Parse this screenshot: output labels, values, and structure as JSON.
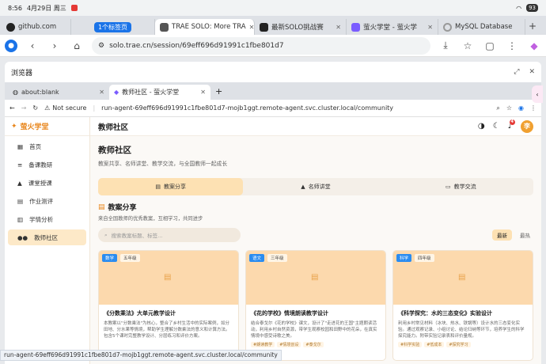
{
  "status": {
    "time": "8:56",
    "date": "4月29日 周三",
    "battery": "93"
  },
  "outer_tabs": [
    {
      "label": "github.com",
      "color": "#222"
    },
    {
      "label": "1个标签页",
      "chip": true
    },
    {
      "label": "TRAE SOLO: More TRA",
      "color": "#555",
      "active": true
    },
    {
      "label": "最新SOLO挑战赛",
      "color": "#222"
    },
    {
      "label": "萤火学堂 - 萤火学",
      "color": "#7a5cff"
    },
    {
      "label": "MySQL Database",
      "color": "#999"
    }
  ],
  "outer_url": "solo.trae.cn/session/69eff696d91991c1fbe801d7",
  "inner": {
    "title": "浏览器",
    "tabs": [
      {
        "label": "about:blank"
      },
      {
        "label": "教师社区 - 萤火学堂",
        "active": true
      }
    ],
    "not_secure": "Not secure",
    "url": "run-agent-69eff696d91991c1fbe801d7-mojb1ggt.remote-agent.svc.cluster.local/community"
  },
  "app": {
    "brand": "萤火学堂",
    "nav": [
      {
        "label": "首页",
        "icon": "home-icon"
      },
      {
        "label": "备课教研",
        "icon": "edit-icon"
      },
      {
        "label": "课堂授课",
        "icon": "graduation-icon"
      },
      {
        "label": "作业测评",
        "icon": "clipboard-icon"
      },
      {
        "label": "学情分析",
        "icon": "chart-icon"
      },
      {
        "label": "教师社区",
        "icon": "people-icon",
        "active": true
      }
    ],
    "topbar_title": "教师社区",
    "bell_count": "4",
    "avatar": "李",
    "page_title": "教师社区",
    "page_sub": "教案共享、名师讲堂、教学交流，与全国教师一起成长",
    "segments": [
      "教案分享",
      "名师讲堂",
      "教学交流"
    ],
    "section_title": "教案分享",
    "section_sub": "来自全国教师的优秀教案，互相学习，共同进步",
    "search_placeholder": "搜索教案标题、标签...",
    "sort": {
      "latest": "最新",
      "hot": "最热"
    },
    "cards": [
      {
        "subject": "数学",
        "grade": "五年级",
        "title": "《分数乘法》大单元教学设计",
        "desc": "本教案以\"分数乘法\"为核心，整合了乡村生活中的实际案例，如分田地、分水果等情境，帮助学生理解分数乘法的意义和计算方法。包含5个课时完整教学设计、分层练习和评价方案。",
        "tags": []
      },
      {
        "subject": "语文",
        "grade": "三年级",
        "title": "《花的学校》情境朗读教学设计",
        "desc": "结合泰戈尔《花的学校》课文，设计了\"走进花的王国\"主题朗读活动，利用乡村自然资源，带学生观察校园和田野中的花朵，在真实情境中感受诗歌之美。",
        "tags": [
          "#朗读教学",
          "#情境创设",
          "#泰戈尔"
        ]
      },
      {
        "subject": "科学",
        "grade": "四年级",
        "title": "《科学探究：水的三态变化》实验设计",
        "desc": "利用乡村常见材料（冰块、热水、铁锅等）设计水的三态变化实验。通过观察记录、小组讨论、结论归纳等环节，培养学生的科学探究能力。附带实验记录表和评价量规。",
        "tags": [
          "#科学实验",
          "#低成本",
          "#探究学习"
        ]
      }
    ]
  },
  "hover_url": "run-agent-69eff696d91991c1fbe801d7-mojb1ggt.remote-agent.svc.cluster.local/community"
}
